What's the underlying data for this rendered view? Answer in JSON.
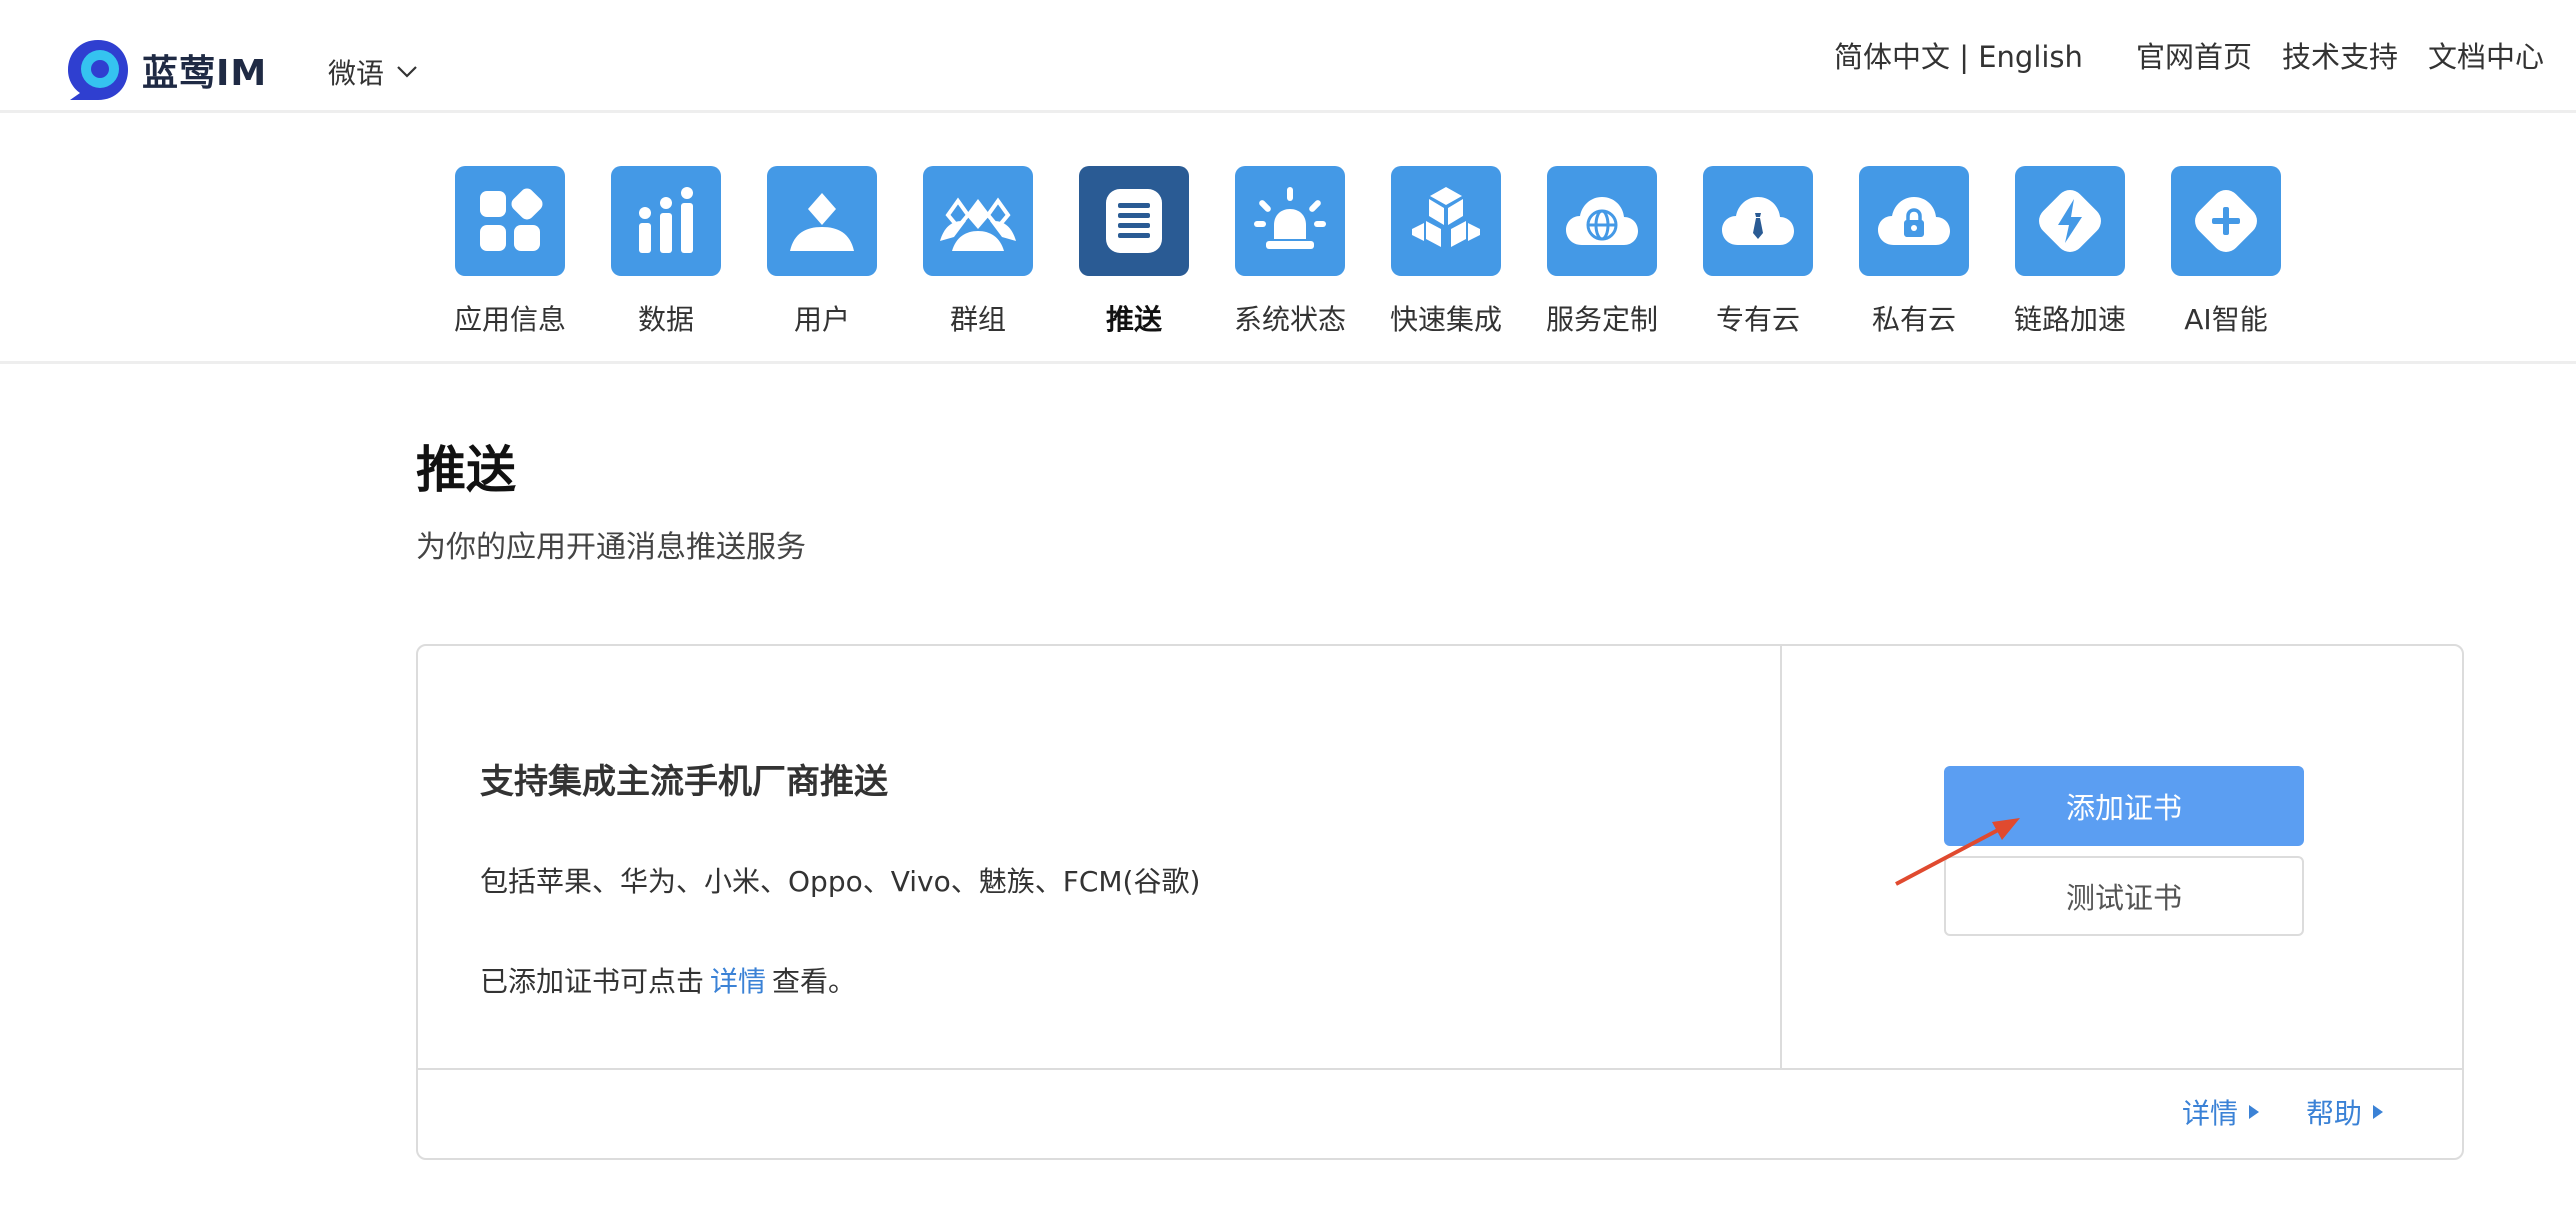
{
  "header": {
    "logo_text": "蓝莺IM",
    "app_selector": "微语",
    "language": "简体中文 | English",
    "links": [
      "官网首页",
      "技术支持",
      "文档中心"
    ]
  },
  "nav": {
    "items": [
      {
        "label": "应用信息",
        "icon": "apps-icon",
        "active": false
      },
      {
        "label": "数据",
        "icon": "data-chart-icon",
        "active": false
      },
      {
        "label": "用户",
        "icon": "user-icon",
        "active": false
      },
      {
        "label": "群组",
        "icon": "group-icon",
        "active": false
      },
      {
        "label": "推送",
        "icon": "push-document-icon",
        "active": true
      },
      {
        "label": "系统状态",
        "icon": "alarm-light-icon",
        "active": false
      },
      {
        "label": "快速集成",
        "icon": "cubes-icon",
        "active": false
      },
      {
        "label": "服务定制",
        "icon": "cloud-globe-icon",
        "active": false
      },
      {
        "label": "专有云",
        "icon": "cloud-tie-icon",
        "active": false
      },
      {
        "label": "私有云",
        "icon": "cloud-lock-icon",
        "active": false
      },
      {
        "label": "链路加速",
        "icon": "lightning-icon",
        "active": false
      },
      {
        "label": "AI智能",
        "icon": "plus-icon",
        "active": false
      }
    ]
  },
  "page": {
    "title": "推送",
    "subtitle": "为你的应用开通消息推送服务"
  },
  "card": {
    "feature_title": "支持集成主流手机厂商推送",
    "feature_desc": "包括苹果、华为、小米、Oppo、Vivo、魅族、FCM(谷歌)",
    "note_prefix": "已添加证书可点击",
    "note_link": "详情",
    "note_suffix": "查看。",
    "add_cert_button": "添加证书",
    "test_cert_button": "测试证书",
    "footer_links": [
      "详情",
      "帮助"
    ]
  },
  "colors": {
    "tile": "#4499e6",
    "tile_active": "#2a5b94",
    "primary_button": "#5b9ef2",
    "link": "#3b82d6",
    "annotation_arrow": "#e04a2f"
  }
}
